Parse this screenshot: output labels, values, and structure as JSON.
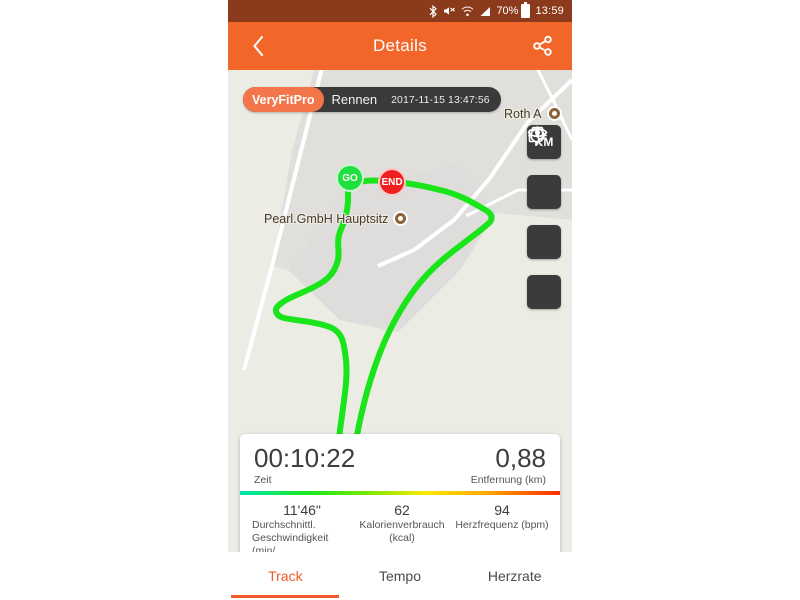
{
  "statusbar": {
    "icons": [
      "bluetooth-icon",
      "mute-icon",
      "wifi-icon",
      "signal-icon"
    ],
    "battery": "70%",
    "time": "13:59"
  },
  "header": {
    "title": "Details",
    "back_label": "back-icon",
    "share_label": "share-icon",
    "color": "#f26729"
  },
  "map": {
    "badge": {
      "brand": "VeryFitPro",
      "activity": "Rennen",
      "timestamp": "2017-11-15 13:47:56"
    },
    "pois": [
      {
        "label": "Roth A"
      },
      {
        "label": "Pearl.GmbH Hauptsitz"
      }
    ],
    "markers": [
      {
        "label": "GO",
        "color": "#20e040"
      },
      {
        "label": "END",
        "color": "#f01f1f"
      }
    ],
    "buttons": [
      {
        "label": "KM",
        "name": "km-unit-button"
      },
      {
        "label": "",
        "name": "layers-button"
      },
      {
        "label": "",
        "name": "locate-button"
      },
      {
        "label": "",
        "name": "visibility-button"
      }
    ],
    "attribution": [
      "G",
      "o",
      "o",
      "g",
      "l",
      "e"
    ],
    "track_color": "#1ae51a"
  },
  "stats": {
    "time": {
      "value": "00:10:22",
      "caption": "Zeit"
    },
    "distance": {
      "value": "0,88",
      "caption": "Entfernung (km)"
    },
    "pace": {
      "value": "11'46\"",
      "caption_line1": "Durchschnittl.",
      "caption_line2": "Geschwindigkeit (min/"
    },
    "calories": {
      "value": "62",
      "caption_line1": "Kalorienverbrauch",
      "caption_line2": "(kcal)"
    },
    "heartrate": {
      "value": "94",
      "caption_line1": "Herzfrequenz (bpm)",
      "caption_line2": ""
    }
  },
  "tabs": [
    {
      "label": "Track",
      "active": true
    },
    {
      "label": "Tempo",
      "active": false
    },
    {
      "label": "Herzrate",
      "active": false
    }
  ]
}
